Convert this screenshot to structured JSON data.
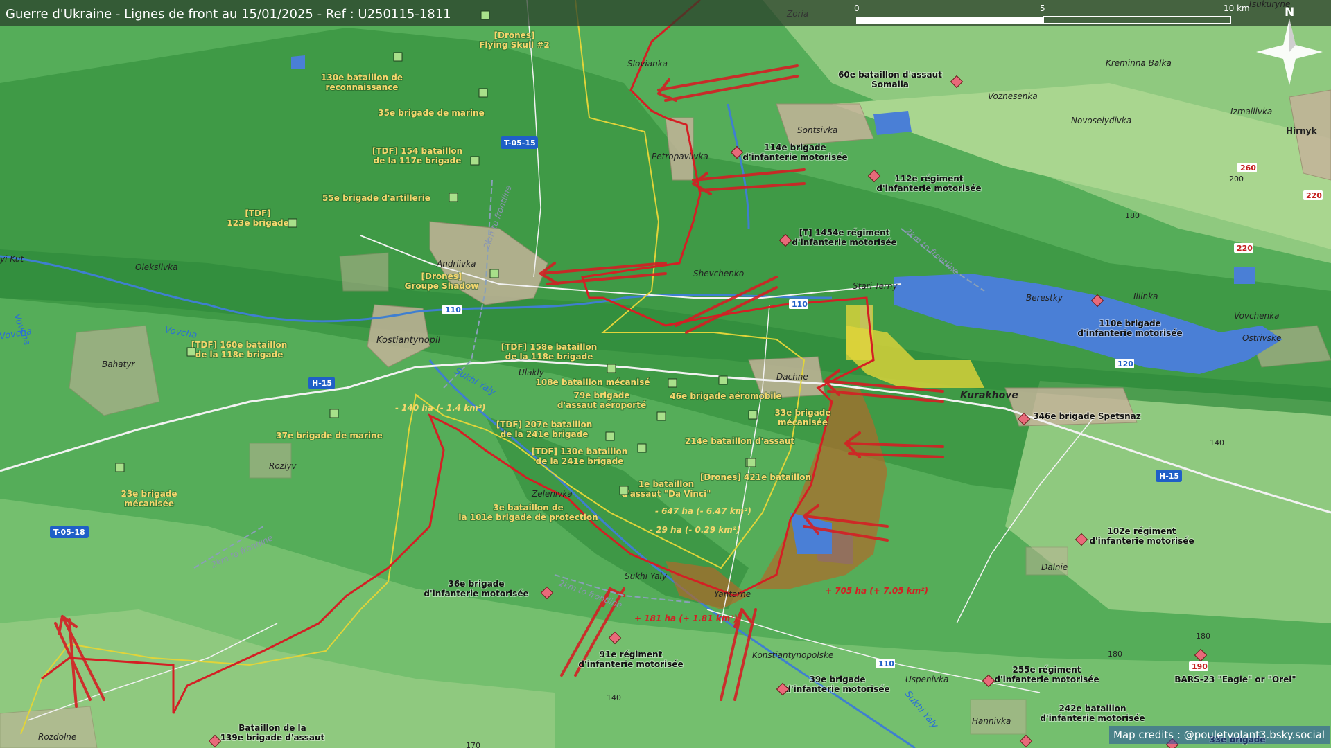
{
  "header": {
    "title": "Guerre d'Ukraine - Lignes de front au 15/01/2025 - Ref : U250115-1811"
  },
  "scale": {
    "labels": [
      "0",
      "5",
      "10 km"
    ]
  },
  "north": {
    "label": "N"
  },
  "credits": "Map credits : @pouletvolant3.bsky.social",
  "colors": {
    "frontline": "#d41f24",
    "previous_line": "#e1d43a",
    "water": "#4a7fd6",
    "gain": "#b06a2a",
    "unit_label": "#f5d76e"
  },
  "places": {
    "zoria": "Zoria",
    "tsukuryne": "Tsukuryne",
    "slovianka": "Slovianka",
    "petropavlivka": "Petropavlivka",
    "sontsivka": "Sontsivka",
    "kreminna_balka": "Kreminna Balka",
    "voznesenka": "Voznesenka",
    "novoselydivka": "Novoselydivka",
    "izmailivka": "Izmailivka",
    "hirnyk": "Hirnyk",
    "oleksiivka": "Oleksiivka",
    "andriivka": "Andriivka",
    "shevchenko": "Shevchenko",
    "stari_terny": "Stari Terny",
    "berestky": "Berestky",
    "illinka": "Illinka",
    "vovchenka": "Vovchenka",
    "ostrivske": "Ostrivske",
    "kostiantynopil": "Kostiantynopil",
    "bahatyr": "Bahatyr",
    "ulakly": "Ulakly",
    "dachne": "Dachne",
    "kurakhove": "Kurakhove",
    "rozlyv": "Rozlyv",
    "zelenivka": "Zelenivka",
    "sukhi_yaly": "Sukhi Yaly",
    "yantarne": "Yantarne",
    "dalnie": "Dalnie",
    "kostiantynopolske": "Konstiantynopolske",
    "uspenivka": "Uspenivka",
    "hannivka": "Hannivka",
    "rozdolne": "Rozdolne",
    "yi_kut": "yi Kut"
  },
  "rivers": {
    "vovcha_a": "Vovcha",
    "vovcha_b": "Vovcha",
    "vovcha_c": "Vovcha",
    "sukhi_yaly_a": "Sukhi Yaly",
    "sukhi_yaly_b": "Sukhi Yaly"
  },
  "roads": {
    "t0515": "T-05-15",
    "h15_a": "H-15",
    "h15_b": "H-15",
    "t0518": "T-05-18",
    "r110_a": "110",
    "r110_b": "110",
    "r110_c": "110",
    "r120": "120",
    "r260": "260",
    "r220_a": "220",
    "r220_b": "220",
    "r190": "190"
  },
  "elevations": {
    "e200": "200",
    "e180_a": "180",
    "e180_b": "180",
    "e180_c": "180",
    "e140_a": "140",
    "e140_b": "140",
    "e170": "170"
  },
  "frontline_labels": {
    "a": "2km to frontline",
    "b": "2km to frontline",
    "c": "2km to frontline",
    "d": "2km to frontline"
  },
  "area_changes": {
    "a": "- 140 ha (- 1.4 km²)",
    "b": "- 647 ha (- 6.47 km²)",
    "c": "- 29 ha (- 0.29 km²)",
    "d": "+ 181 ha (+ 1.81 km²)",
    "e": "+ 705 ha (+ 7.05 km²)"
  },
  "ua_units": {
    "flying_skull": [
      "[Drones]",
      "Flying Skull #2"
    ],
    "bat130": [
      "130e bataillon de",
      "reconnaissance"
    ],
    "br35": [
      "35e brigade de marine"
    ],
    "tdf154": [
      "[TDF] 154 bataillon",
      "de la 117e brigade"
    ],
    "art55": [
      "55e brigade d'artillerie"
    ],
    "tdf123": [
      "[TDF]",
      "123e brigade"
    ],
    "shadow": [
      "[Drones]",
      "Groupe Shadow"
    ],
    "tdf160": [
      "[TDF] 160e bataillon",
      "de la 118e brigade"
    ],
    "tdf158": [
      "[TDF] 158e bataillon",
      "de la 118e brigade"
    ],
    "bat108": [
      "108e bataillon mécanisé"
    ],
    "br79": [
      "79e brigade",
      "d'assaut aéroporté"
    ],
    "br46": [
      "46e brigade aéromobile"
    ],
    "br33": [
      "33e brigade",
      "mécanisée"
    ],
    "tdf207": [
      "[TDF] 207e bataillon",
      "de la 241e brigade"
    ],
    "bat214": [
      "214e bataillon d'assaut"
    ],
    "tdf130": [
      "[TDF] 130e bataillon",
      "de la 241e brigade"
    ],
    "br37": [
      "37e brigade de marine"
    ],
    "br23": [
      "23e brigade",
      "mécanisée"
    ],
    "davinci": [
      "1e bataillon",
      "d'assaut \"Da Vinci\""
    ],
    "dr421": [
      "[Drones] 421e bataillon"
    ],
    "bat3": [
      "3e bataillon de",
      "la 101e brigade de protection"
    ]
  },
  "ru_units": {
    "somalia": [
      "60e bataillon d'assaut",
      "Somalia"
    ],
    "br114": [
      "114e brigade",
      "d'infanterie motorisée"
    ],
    "reg112": [
      "112e régiment",
      "d'infanterie motorisée"
    ],
    "reg1454": [
      "[T] 1454e régiment",
      "d'infanterie motorisée"
    ],
    "br110": [
      "110e brigade",
      "d'infanterie motorisée"
    ],
    "br346": [
      "346e brigade Spetsnaz"
    ],
    "reg102": [
      "102e régiment",
      "d'infanterie motorisée"
    ],
    "br36": [
      "36e brigade",
      "d'infanterie motorisée"
    ],
    "reg91": [
      "91e régiment",
      "d'infanterie motorisée"
    ],
    "br39": [
      "39e brigade",
      "d'infanterie motorisée"
    ],
    "reg255": [
      "255e régiment",
      "d'infanterie motorisée"
    ],
    "bars23": [
      "BARS-23 \"Eagle\" or \"Orel\""
    ],
    "bat242": [
      "242e bataillon",
      "d'infanterie motorisée"
    ],
    "br33r": [
      "33e brigade"
    ],
    "bat139": [
      "Bataillon de la",
      "139e brigade d'assaut"
    ]
  }
}
